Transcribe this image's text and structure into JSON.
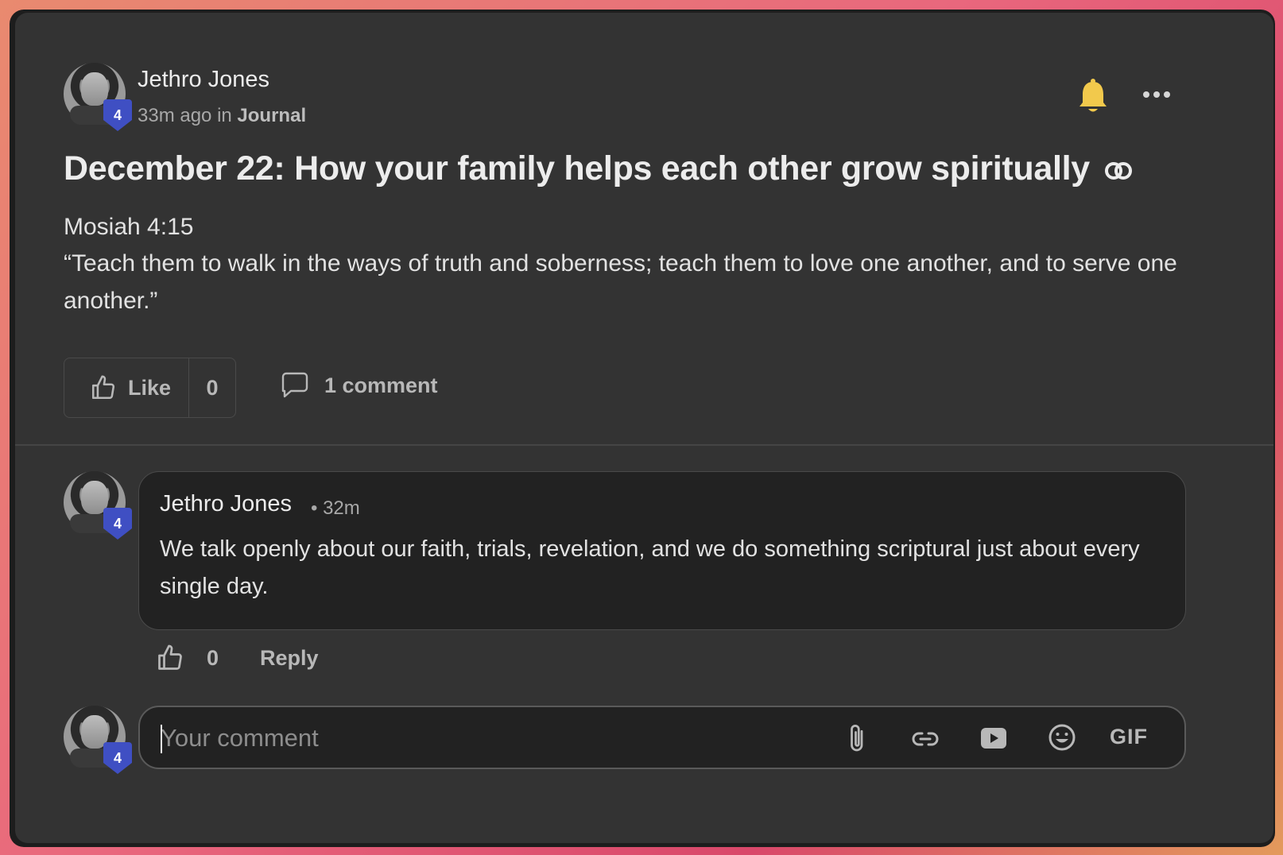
{
  "post": {
    "author": "Jethro Jones",
    "author_level": "4",
    "time_ago": "33m ago in",
    "space": "Journal",
    "title": "December 22: How your family helps each other grow spiritually",
    "body_line1": "Mosiah 4:15",
    "body_line2": "“Teach them to walk in the ways of truth and soberness; teach them to love one another, and to serve one another.”",
    "like_label": "Like",
    "like_count": "0",
    "comments_label": "1 comment",
    "bell_color": "#f2c94c"
  },
  "comment": {
    "author": "Jethro Jones",
    "author_level": "4",
    "time": "• 32m",
    "text": "We talk openly about our faith, trials, revelation, and we do something scriptural just about every single day.",
    "like_count": "0",
    "reply_label": "Reply"
  },
  "composer": {
    "author_level": "4",
    "placeholder": "Your comment",
    "gif_label": "GIF",
    "tools": [
      "paperclip-icon",
      "link-icon",
      "video-icon",
      "emoji-icon"
    ]
  }
}
